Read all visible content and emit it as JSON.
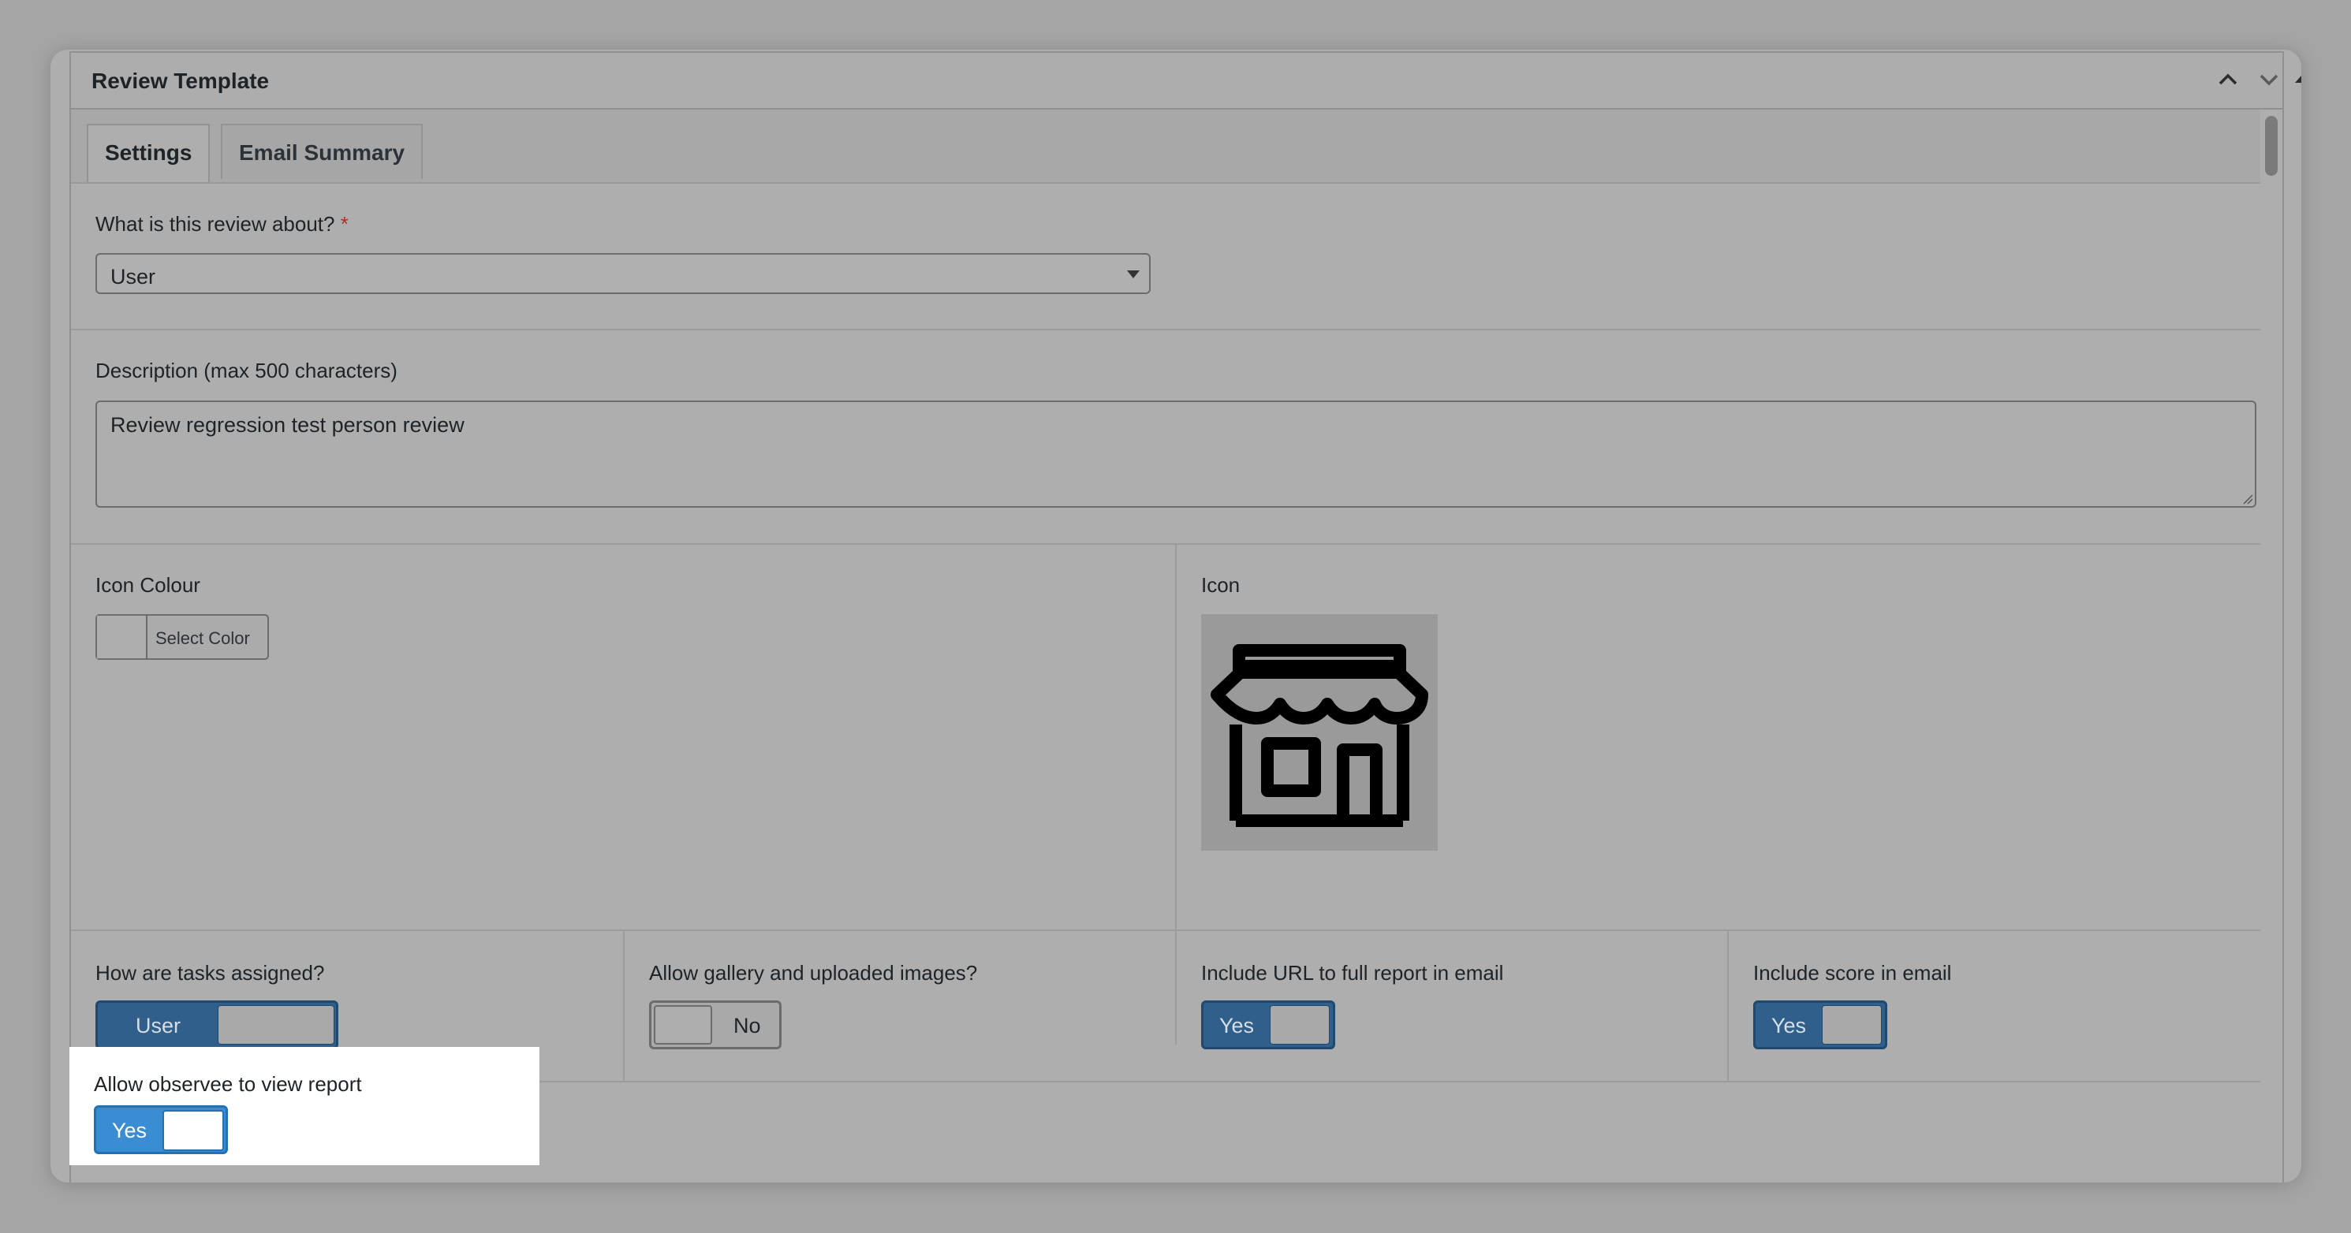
{
  "panel": {
    "title": "Review Template",
    "header_controls": [
      "chevron-up-icon",
      "chevron-down-icon",
      "triangle-up-icon"
    ]
  },
  "tabs": [
    {
      "label": "Settings",
      "active": true
    },
    {
      "label": "Email Summary",
      "active": false
    }
  ],
  "about": {
    "label": "What is this review about?",
    "required_mark": "*",
    "selected": "User"
  },
  "description": {
    "label": "Description (max 500 characters)",
    "value": "Review regression test person review"
  },
  "icon_colour": {
    "label": "Icon Colour",
    "button_label": "Select Color"
  },
  "icon": {
    "label": "Icon",
    "icon_name": "storefront-icon"
  },
  "toggles": {
    "tasks_assigned": {
      "label": "How are tasks assigned?",
      "value": "User"
    },
    "gallery": {
      "label": "Allow gallery and uploaded images?",
      "value": "No"
    },
    "include_url": {
      "label": "Include URL to full report in email",
      "value": "Yes"
    },
    "include_score": {
      "label": "Include score in email",
      "value": "Yes"
    },
    "observee_view": {
      "label": "Allow observee to view report",
      "value": "Yes"
    }
  },
  "colors": {
    "toggle_on": "#2f5f8a",
    "toggle_on_highlight": "#3a8dd2",
    "required": "#b32d2e",
    "highlight_bg": "#ffffff"
  }
}
